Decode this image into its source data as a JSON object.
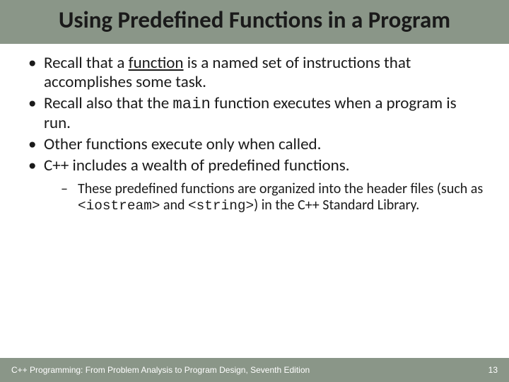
{
  "title": "Using Predefined Functions in a Program",
  "bullets": {
    "b1_a": "Recall that a ",
    "b1_u": "function",
    "b1_b": " is a named set of instructions that accomplishes some task.",
    "b2_a": "Recall also that the ",
    "b2_code": "main",
    "b2_b": " function executes when a program is run.",
    "b3": "Other functions execute only when called.",
    "b4": "C++ includes a wealth of predefined functions.",
    "sub_a": "These predefined functions are organized into the header files (such as ",
    "sub_code1": "<iostream>",
    "sub_mid": " and ",
    "sub_code2": "<string>",
    "sub_b": ") in the C++ Standard Library."
  },
  "footer": {
    "left": "C++ Programming: From Problem Analysis to Program Design, Seventh Edition",
    "right": "13"
  }
}
